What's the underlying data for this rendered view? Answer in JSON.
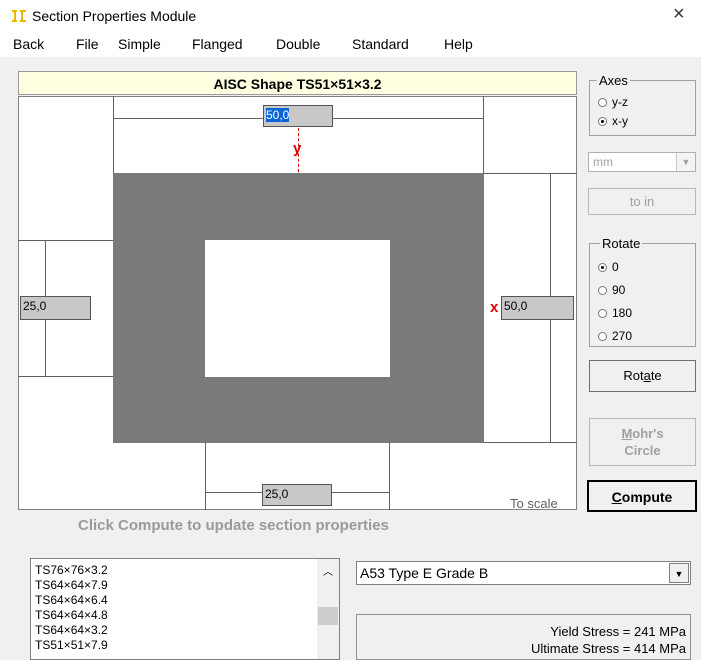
{
  "window": {
    "title": "Section Properties Module",
    "close_icon": "×"
  },
  "menu": [
    "Back",
    "File",
    "Simple",
    "Flanged",
    "Double",
    "Standard",
    "Help"
  ],
  "header": {
    "shape_title": "AISC Shape  TS51×51×3.2"
  },
  "drawing": {
    "dim_top": "50,0",
    "dim_left": "25,0",
    "dim_right": "50,0",
    "dim_bottom": "25,0",
    "axis_y": "y",
    "axis_x": "x",
    "to_scale": "To scale"
  },
  "hint": "Click Compute to update section properties",
  "axes": {
    "title": "Axes",
    "options": [
      "y-z",
      "x-y"
    ],
    "selected": "x-y"
  },
  "units": {
    "value": "mm"
  },
  "to_in_label": "to in",
  "rotate": {
    "title": "Rotate",
    "options": [
      "0",
      "90",
      "180",
      "270"
    ],
    "selected": "0",
    "button": "Rotate"
  },
  "mohr": {
    "line1": "Mohr's",
    "line2": "Circle"
  },
  "compute_label": "Compute",
  "shape_list": [
    "TS76×76×3.2",
    "TS64×64×7.9",
    "TS64×64×6.4",
    "TS64×64×4.8",
    "TS64×64×3.2",
    "TS51×51×7.9"
  ],
  "material": {
    "value": "A53 Type E Grade B"
  },
  "properties": {
    "yield": "Yield Stress = 241 MPa",
    "ultimate": "Ultimate Stress = 414 MPa"
  }
}
